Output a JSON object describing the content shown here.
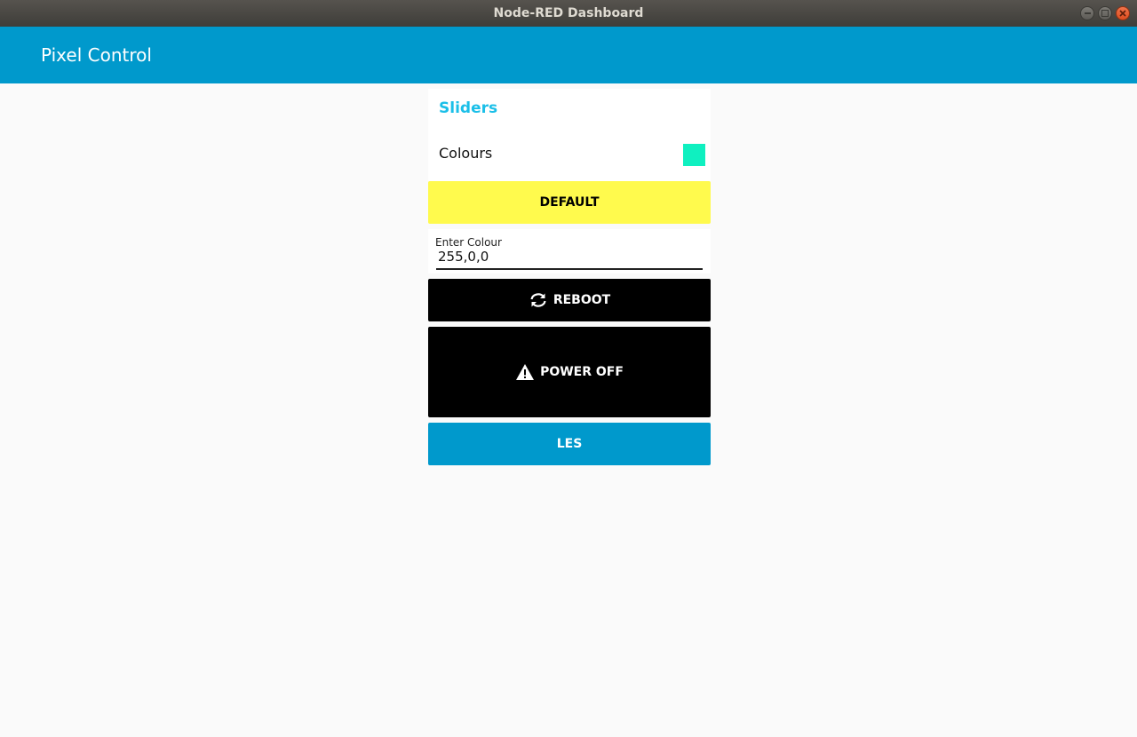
{
  "window": {
    "title": "Node-RED Dashboard"
  },
  "appbar": {
    "title": "Pixel Control"
  },
  "group": {
    "title": "Sliders",
    "colour_label": "Colours",
    "colour_value": "#0ff0c0"
  },
  "buttons": {
    "default": {
      "label": "DEFAULT",
      "bg": "#fffa4d",
      "color": "#000000"
    },
    "reboot": {
      "label": "REBOOT",
      "icon": "refresh-icon",
      "bg": "#000000",
      "color": "#ffffff"
    },
    "power_off": {
      "label": "POWER OFF",
      "icon": "warning-icon",
      "bg": "#000000",
      "color": "#ffffff"
    },
    "les": {
      "label": "LES",
      "bg": "#0099cc",
      "color": "#ffffff"
    }
  },
  "text_input": {
    "label": "Enter Colour",
    "value": "255,0,0"
  },
  "colors": {
    "accent": "#0099cc",
    "group_title": "#1bbfe8"
  }
}
